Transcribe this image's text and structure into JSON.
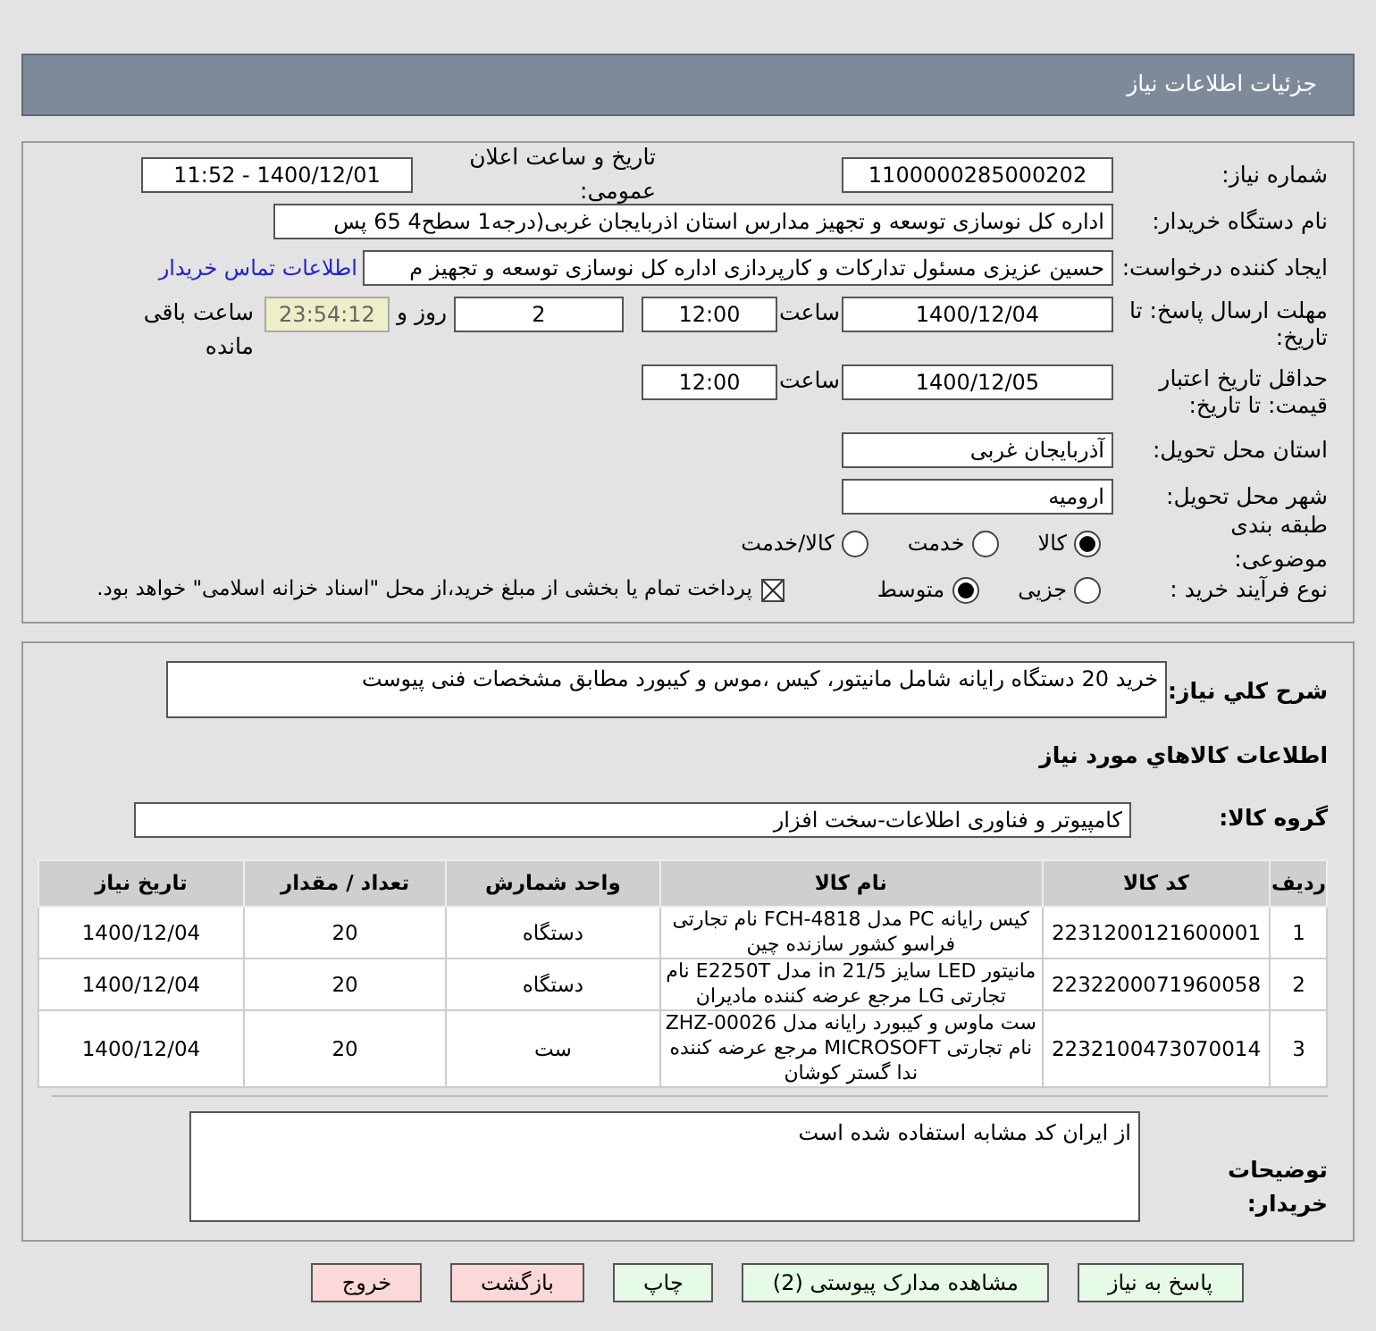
{
  "header": {
    "title": "جزئیات اطلاعات نیاز"
  },
  "details": {
    "need_number": {
      "label": "شماره نیاز:",
      "value": "1100000285000202"
    },
    "announce": {
      "label": "تاریخ و ساعت اعلان عمومی:",
      "value": "1400/12/01 - 11:52"
    },
    "buyer_org": {
      "label": "نام دستگاه خریدار:",
      "value": "اداره کل نوسازی   توسعه و تجهیز مدارس استان اذربایجان غربی(درجه1  سطح4  65 پس"
    },
    "requester": {
      "label": "ایجاد کننده درخواست:",
      "value": "حسین  عزیزی مسئول تدارکات و کارپردازی اداره کل نوسازی   توسعه و تجهیز م",
      "link": "اطلاعات تماس خریدار"
    },
    "deadline": {
      "label": "مهلت ارسال پاسخ: تا تاریخ:",
      "date": "1400/12/04",
      "time_label": "ساعت",
      "time": "12:00",
      "days": "2",
      "days_label": "روز و",
      "remaining": "23:54:12",
      "remaining_label": "ساعت باقی مانده"
    },
    "price_validity": {
      "label": "حداقل تاریخ اعتبار قیمت: تا تاریخ:",
      "date": "1400/12/05",
      "time_label": "ساعت",
      "time": "12:00"
    },
    "province": {
      "label": "استان محل تحویل:",
      "value": "آذربایجان غربی"
    },
    "city": {
      "label": "شهر محل تحویل:",
      "value": "ارومیه"
    },
    "category": {
      "label": "طبقه بندی موضوعی:",
      "options": [
        {
          "label": "کالا",
          "selected": true
        },
        {
          "label": "خدمت",
          "selected": false
        },
        {
          "label": "کالا/خدمت",
          "selected": false
        }
      ]
    },
    "process": {
      "label": "نوع فرآیند خرید :",
      "options": [
        {
          "label": "جزیی",
          "selected": false
        },
        {
          "label": "متوسط",
          "selected": true
        }
      ],
      "payment": {
        "checked": true,
        "label": "پرداخت تمام یا بخشی از مبلغ خرید،از محل \"اسناد خزانه اسلامی\" خواهد بود."
      }
    }
  },
  "goods": {
    "description": {
      "label": "شرح کلي نياز:",
      "value": "خرید 20 دستگاه رایانه شامل مانیتور، کیس ،موس و کیبورد مطابق مشخصات فنی پیوست"
    },
    "heading": "اطلاعات كالاهاي مورد نياز",
    "group": {
      "label": "گروه کالا:",
      "value": "کامپیوتر و فناوری اطلاعات-سخت افزار"
    },
    "table": {
      "columns": [
        "ردیف",
        "کد کالا",
        "نام کالا",
        "واحد شمارش",
        "تعداد / مقدار",
        "تاریخ نیاز"
      ],
      "rows": [
        [
          "1",
          "2231200121600001",
          "کیس رایانه PC مدل FCH-4818 نام تجارتی فراسو کشور سازنده چین",
          "دستگاه",
          "20",
          "1400/12/04"
        ],
        [
          "2",
          "2232200071960058",
          "مانیتور LED سایز 21/5 in مدل E2250T نام تجارتی LG مرجع عرضه کننده مادیران",
          "دستگاه",
          "20",
          "1400/12/04"
        ],
        [
          "3",
          "2232100473070014",
          "ست ماوس و کیبورد رایانه مدل ZHZ-00026 نام تجارتی MICROSOFT مرجع عرضه کننده ندا گستر کوشان",
          "ست",
          "20",
          "1400/12/04"
        ]
      ]
    },
    "notes": {
      "label": "توضیحات خریدار:",
      "value": "از ایران کد مشابه استفاده شده است"
    }
  },
  "buttons": [
    {
      "label": "پاسخ به نیاز",
      "kind": "primary"
    },
    {
      "label": "مشاهده مدارک پیوستی (2)",
      "kind": "primary"
    },
    {
      "label": "چاپ",
      "kind": "primary"
    },
    {
      "label": "بازگشت",
      "kind": "danger"
    },
    {
      "label": "خروج",
      "kind": "danger"
    }
  ]
}
